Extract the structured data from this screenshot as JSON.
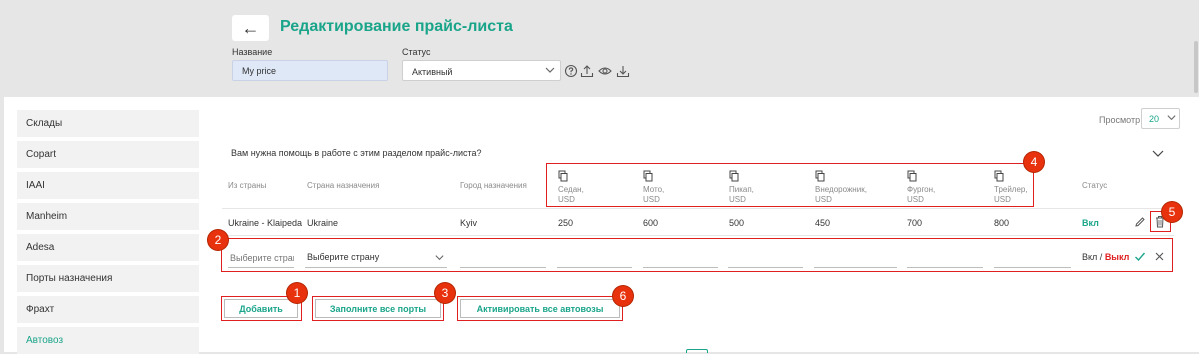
{
  "header": {
    "back_glyph": "←",
    "title": "Редактирование прайс-листа",
    "name_label": "Название",
    "name_value": "My price",
    "status_label": "Статус",
    "status_value": "Активный"
  },
  "sidebar": {
    "items": [
      {
        "label": "Склады"
      },
      {
        "label": "Copart"
      },
      {
        "label": "IAAI"
      },
      {
        "label": "Manheim"
      },
      {
        "label": "Adesa"
      },
      {
        "label": "Порты назначения"
      },
      {
        "label": "Фрахт"
      },
      {
        "label": "Автовоз"
      }
    ],
    "active_index": 7
  },
  "preview": {
    "label": "Просмотр",
    "value": "20"
  },
  "help_text": "Вам нужна помощь в работе с этим разделом прайс-листа?",
  "table": {
    "columns": {
      "from_country": "Из страны",
      "dest_country": "Страна назначения",
      "dest_city": "Город назначения",
      "sedan": [
        "Седан,",
        "USD"
      ],
      "moto": [
        "Мото,",
        "USD"
      ],
      "pickup": [
        "Пикап,",
        "USD"
      ],
      "suv": [
        "Внедорожник,",
        "USD"
      ],
      "van": [
        "Фургон,",
        "USD"
      ],
      "trailer": [
        "Трейлер,",
        "USD"
      ],
      "status": "Статус"
    },
    "row": {
      "from_country": "Ukraine - Klaipeda",
      "dest_country": "Ukraine",
      "dest_city": "Kyiv",
      "sedan": "250",
      "moto": "600",
      "pickup": "500",
      "suv": "450",
      "van": "700",
      "trailer": "800",
      "status": "Вкл"
    },
    "new_row": {
      "from_placeholder": "Выберите страну",
      "dest_placeholder": "Выберите страну",
      "status_on": "Вкл",
      "status_sep": " / ",
      "status_off": "Выкл"
    }
  },
  "buttons": {
    "add": "Добавить",
    "fill_ports": "Заполните все порты",
    "activate_all": "Активировать все автовозы"
  },
  "badges": {
    "b1": "1",
    "b2": "2",
    "b3": "3",
    "b4": "4",
    "b5": "5",
    "b6": "6"
  },
  "colors": {
    "accent": "#1aa58a",
    "annotation": "#e02020",
    "badge": "#e8320e"
  }
}
